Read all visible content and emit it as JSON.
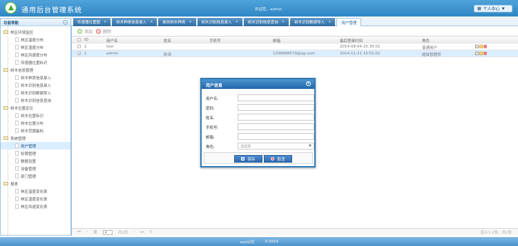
{
  "header": {
    "title": "通用后台管理系统",
    "welcome": "欢迎您，admin",
    "user_center": "个人中心"
  },
  "sidebar": {
    "title": "功能导航",
    "items": [
      {
        "label": "林区环境监控",
        "type": "group"
      },
      {
        "label": "林区温度分布",
        "type": "child"
      },
      {
        "label": "林区湿度分布",
        "type": "child"
      },
      {
        "label": "林区风速度分布",
        "type": "child"
      },
      {
        "label": "传感器位置标识",
        "type": "child"
      },
      {
        "label": "树木信息管理",
        "type": "group"
      },
      {
        "label": "树木种类信息录入",
        "type": "child"
      },
      {
        "label": "树木识别信息录入",
        "type": "child"
      },
      {
        "label": "树木识别数据导入",
        "type": "child"
      },
      {
        "label": "树木识别信息查询",
        "type": "child"
      },
      {
        "label": "树木位置定位",
        "type": "group"
      },
      {
        "label": "树木位置标识",
        "type": "child"
      },
      {
        "label": "树木位置分布",
        "type": "child"
      },
      {
        "label": "树木范围备标",
        "type": "child"
      },
      {
        "label": "系统管理",
        "type": "group"
      },
      {
        "label": "用户管理",
        "type": "child",
        "active": true
      },
      {
        "label": "权限管理",
        "type": "child"
      },
      {
        "label": "数据设置",
        "type": "child"
      },
      {
        "label": "设备管理",
        "type": "child"
      },
      {
        "label": "部门管理",
        "type": "child"
      },
      {
        "label": "报表",
        "type": "group"
      },
      {
        "label": "林区温度变化表",
        "type": "child"
      },
      {
        "label": "林区湿度变化表",
        "type": "child"
      },
      {
        "label": "林区风速变化表",
        "type": "child"
      }
    ]
  },
  "tabs": [
    {
      "label": "传感器位置图"
    },
    {
      "label": "树木种类信息录入"
    },
    {
      "label": "新的树木种类"
    },
    {
      "label": "树木识别信息录入"
    },
    {
      "label": "树木识别信息查询"
    },
    {
      "label": "树木识别数据导入"
    },
    {
      "label": "用户管理",
      "active": true
    }
  ],
  "toolbar": {
    "add": "添加",
    "delete": "删除"
  },
  "table": {
    "columns": [
      "ID",
      "用户名",
      "姓名",
      "手机号",
      "邮箱",
      "最后登录时间",
      "角色"
    ],
    "rows": [
      {
        "id": "2",
        "username": "test",
        "name": "",
        "phone": "",
        "email": "",
        "last_login": "2014-08-04 15:35:01",
        "role": "普通用户",
        "selected": false
      },
      {
        "id": "1",
        "username": "admin",
        "name": "陈涛",
        "phone": "",
        "email": "1296888579@qq.com",
        "last_login": "2014-11-21 15:51:02",
        "role": "超级管理员",
        "selected": true
      }
    ]
  },
  "pager": {
    "page_prefix": "第",
    "page_value": "1",
    "page_suffix": "共1页",
    "info": "显示1-2条，共2条"
  },
  "dialog": {
    "title": "用户信息",
    "labels": {
      "username": "用户名:",
      "password": "密码:",
      "name": "姓名:",
      "phone": "手机号:",
      "email": "邮箱:",
      "role": "角色:"
    },
    "role_placeholder": "请选择",
    "save": "保存",
    "cancel": "取消"
  },
  "footer": {
    "company": "xxx公司",
    "copyright": "©2014"
  }
}
